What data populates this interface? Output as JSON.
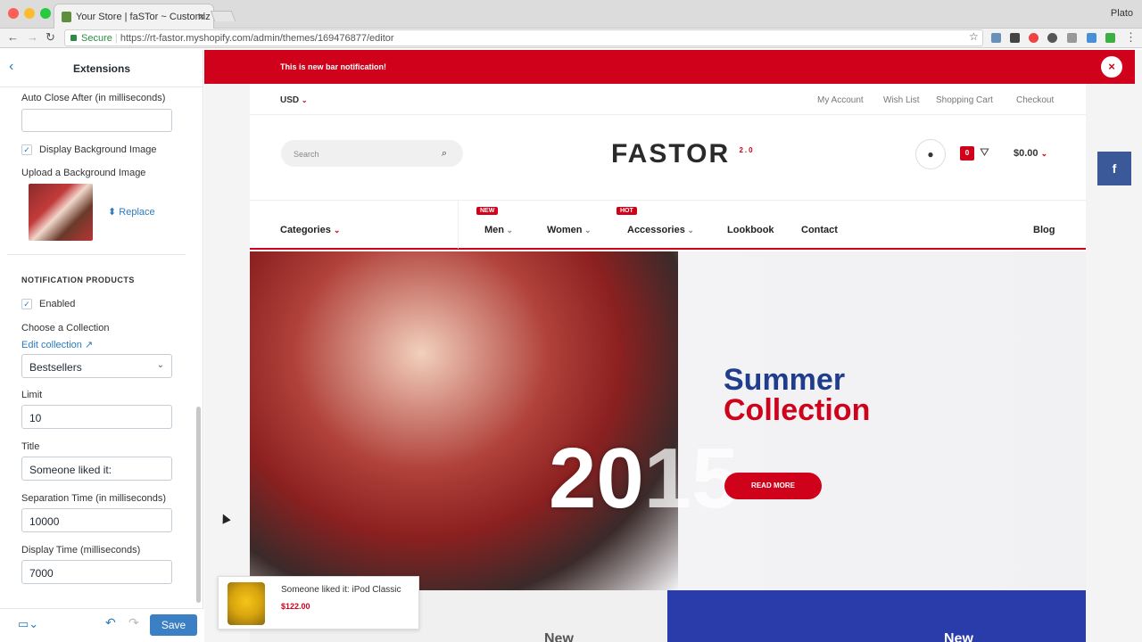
{
  "browser": {
    "tab_title": "Your Store | faSTor ~ Customiz",
    "profile": "Plato",
    "secure_label": "Secure",
    "url": "https://rt-fastor.myshopify.com/admin/themes/169476877/editor"
  },
  "panel": {
    "title": "Extensions",
    "auto_close_label": "Auto Close After (in milliseconds)",
    "auto_close_value": "",
    "display_bg_label": "Display Background Image",
    "upload_bg_label": "Upload a Background Image",
    "replace_label": "Replace",
    "section_title": "NOTIFICATION PRODUCTS",
    "enabled_label": "Enabled",
    "collection_label": "Choose a Collection",
    "edit_collection_label": "Edit collection",
    "collection_value": "Bestsellers",
    "limit_label": "Limit",
    "limit_value": "10",
    "title_label": "Title",
    "title_value": "Someone liked it:",
    "separation_label": "Separation Time (in milliseconds)",
    "separation_value": "10000",
    "display_time_label": "Display Time (milliseconds)",
    "display_time_value": "7000",
    "save_label": "Save"
  },
  "preview": {
    "notification_text": "This is new bar notification!",
    "currency": "USD",
    "top_links": [
      "My Account",
      "Wish List",
      "Shopping Cart",
      "Checkout"
    ],
    "search_placeholder": "Search",
    "logo": "FASTOR",
    "logo_sup": "2.0",
    "cart_count": "0",
    "cart_total": "$0.00",
    "nav": {
      "categories": "Categories",
      "items": [
        "Men",
        "Women",
        "Accessories",
        "Lookbook",
        "Contact"
      ],
      "blog": "Blog",
      "badge_new": "NEW",
      "badge_hot": "HOT"
    },
    "hero": {
      "line1": "Summer",
      "line2": "Collection",
      "year_main": "20",
      "year_faint": "15",
      "button": "READ MORE"
    },
    "lower_banner_text": "New",
    "toast": {
      "text": "Someone liked it: iPod Classic",
      "price": "$122.00"
    }
  },
  "colors": {
    "accent_red": "#d0021b",
    "brand_blue": "#1f3d8c",
    "save_blue": "#3b7fc4",
    "facebook": "#3b5998"
  }
}
